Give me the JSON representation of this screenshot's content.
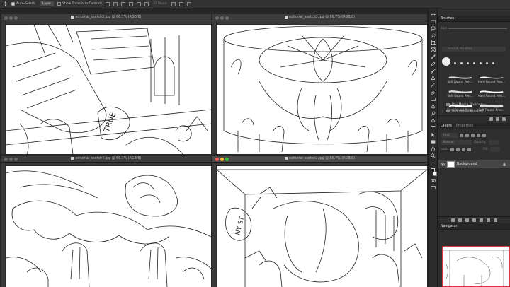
{
  "options_bar": {
    "auto_select_label": "Auto-Select:",
    "auto_select_target": "Layer",
    "show_transform_label": "Show Transform Controls",
    "mode_label": "3D Mode:"
  },
  "documents": [
    {
      "id": "doc1",
      "title": "editorial_sketch2.jpg @ 66.7% (RGB/8)"
    },
    {
      "id": "doc2",
      "title": "editorial_sketch3.jpg @ 66.7% (RGB/8)"
    },
    {
      "id": "doc3",
      "title": "editorial_sketch4.jpg @ 66.7% (RGB/8)"
    },
    {
      "id": "doc4",
      "title": "editorial_sketch1.jpg @ 66.7% (RGB/8)"
    }
  ],
  "brushes_panel": {
    "tab": "Brushes",
    "size_label": "Size",
    "search_placeholder": "Search Brushes",
    "presets": [
      {
        "name": "Soft Round Pres..."
      },
      {
        "name": "Hard Round Pres..."
      },
      {
        "name": "Soft Round Pres..."
      },
      {
        "name": "Hard Round Pres..."
      },
      {
        "name": "Hard Round Pres..."
      },
      {
        "name": "Soft Round Pres..."
      }
    ],
    "folders": [
      "Dry Media Brushes",
      "Wet Media Brushes"
    ]
  },
  "layers_panel": {
    "tabs": [
      "Layers",
      "Properties"
    ],
    "filter_label": "Kind",
    "blend_mode": "Normal",
    "opacity_label": "Opacity:",
    "lock_label": "Lock:",
    "fill_label": "Fill:",
    "layer_name": "Background"
  },
  "navigator_panel": {
    "tab": "Navigator"
  }
}
